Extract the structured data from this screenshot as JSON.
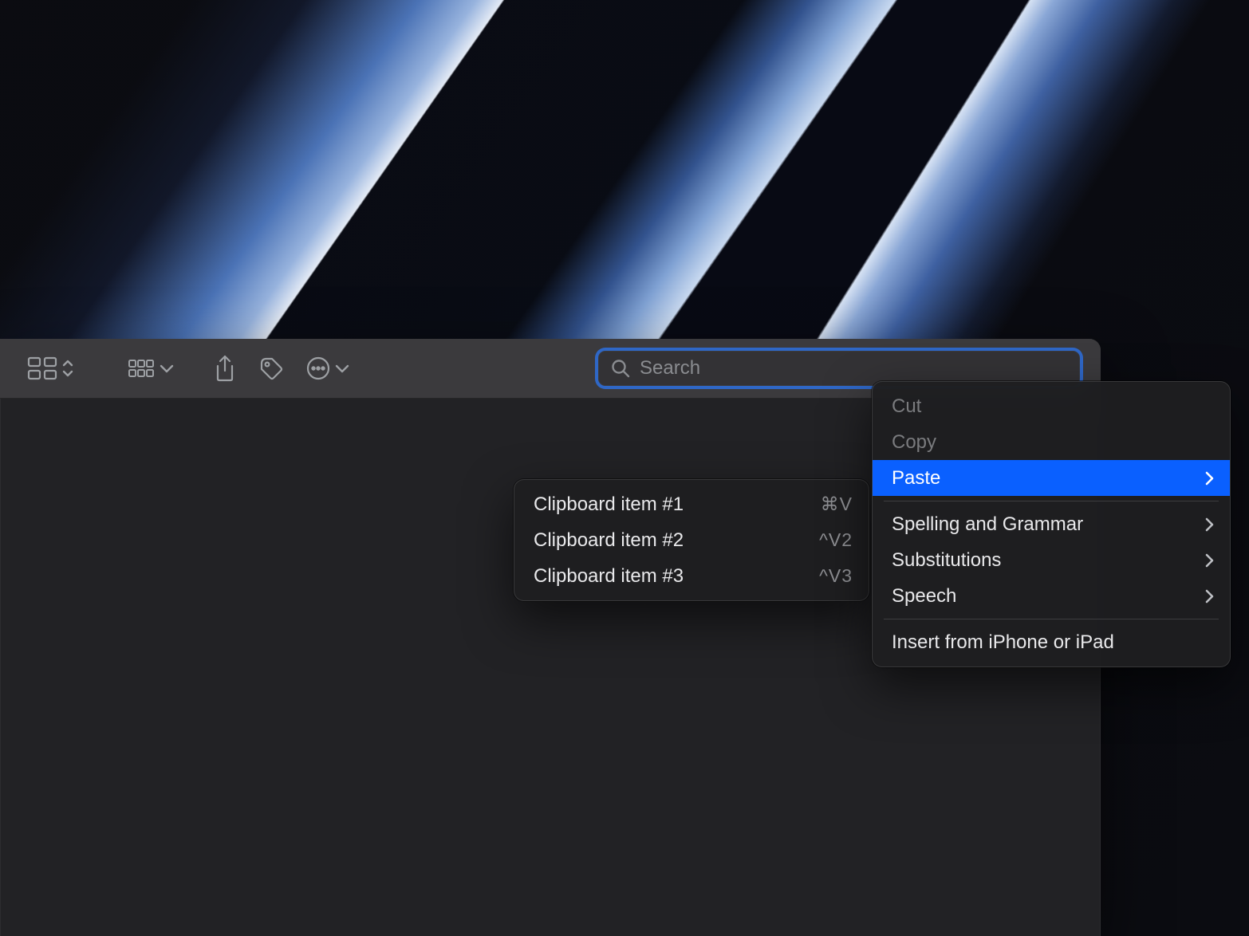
{
  "toolbar": {
    "search_placeholder": "Search"
  },
  "context_menu": {
    "cut": "Cut",
    "copy": "Copy",
    "paste": "Paste",
    "spelling": "Spelling and Grammar",
    "substitutions": "Substitutions",
    "speech": "Speech",
    "insert": "Insert from iPhone or iPad"
  },
  "clipboard_menu": {
    "items": [
      {
        "label": "Clipboard item #1",
        "shortcut": "⌘V"
      },
      {
        "label": "Clipboard item #2",
        "shortcut": "^V2"
      },
      {
        "label": "Clipboard item #3",
        "shortcut": "^V3"
      }
    ]
  }
}
